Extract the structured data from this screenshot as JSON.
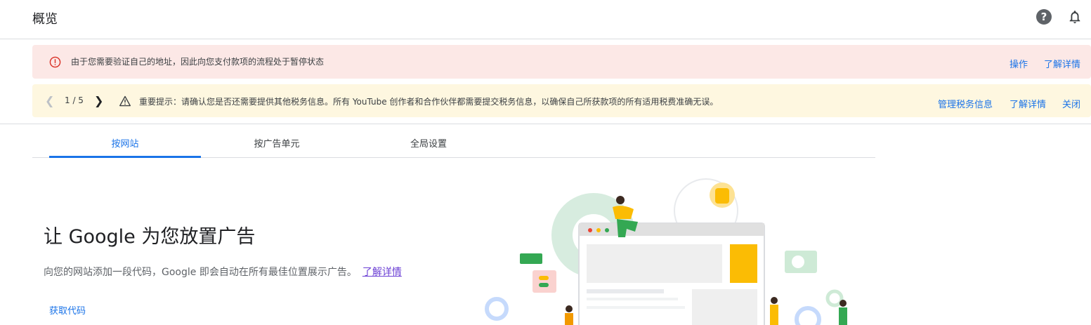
{
  "header": {
    "title": "概览",
    "help_icon": "?"
  },
  "alert": {
    "message": "由于您需要验证自己的地址，因此向您支付款项的流程处于暂停状态",
    "action_label": "操作",
    "learn_more_label": "了解详情"
  },
  "notice": {
    "pager": "1 / 5",
    "message": "重要提示：请确认您是否还需要提供其他税务信息。所有 YouTube 创作者和合作伙伴都需要提交税务信息，以确保自己所获款项的所有适用税费准确无误。",
    "manage_label": "管理税务信息",
    "learn_more_label": "了解详情",
    "close_label": "关闭"
  },
  "tabs": [
    {
      "label": "按网站",
      "active": true
    },
    {
      "label": "按广告单元",
      "active": false
    },
    {
      "label": "全局设置",
      "active": false
    }
  ],
  "hero": {
    "title": "让 Google 为您放置广告",
    "description": "向您的网站添加一段代码，Google 即会自动在所有最佳位置展示广告。",
    "learn_more_label": "了解详情",
    "get_code_label": "获取代码"
  },
  "colors": {
    "accent": "#1a73e8",
    "error_bg": "#fce8e6",
    "warning_bg": "#fef7e0",
    "link_visited": "#6b3fd4"
  }
}
